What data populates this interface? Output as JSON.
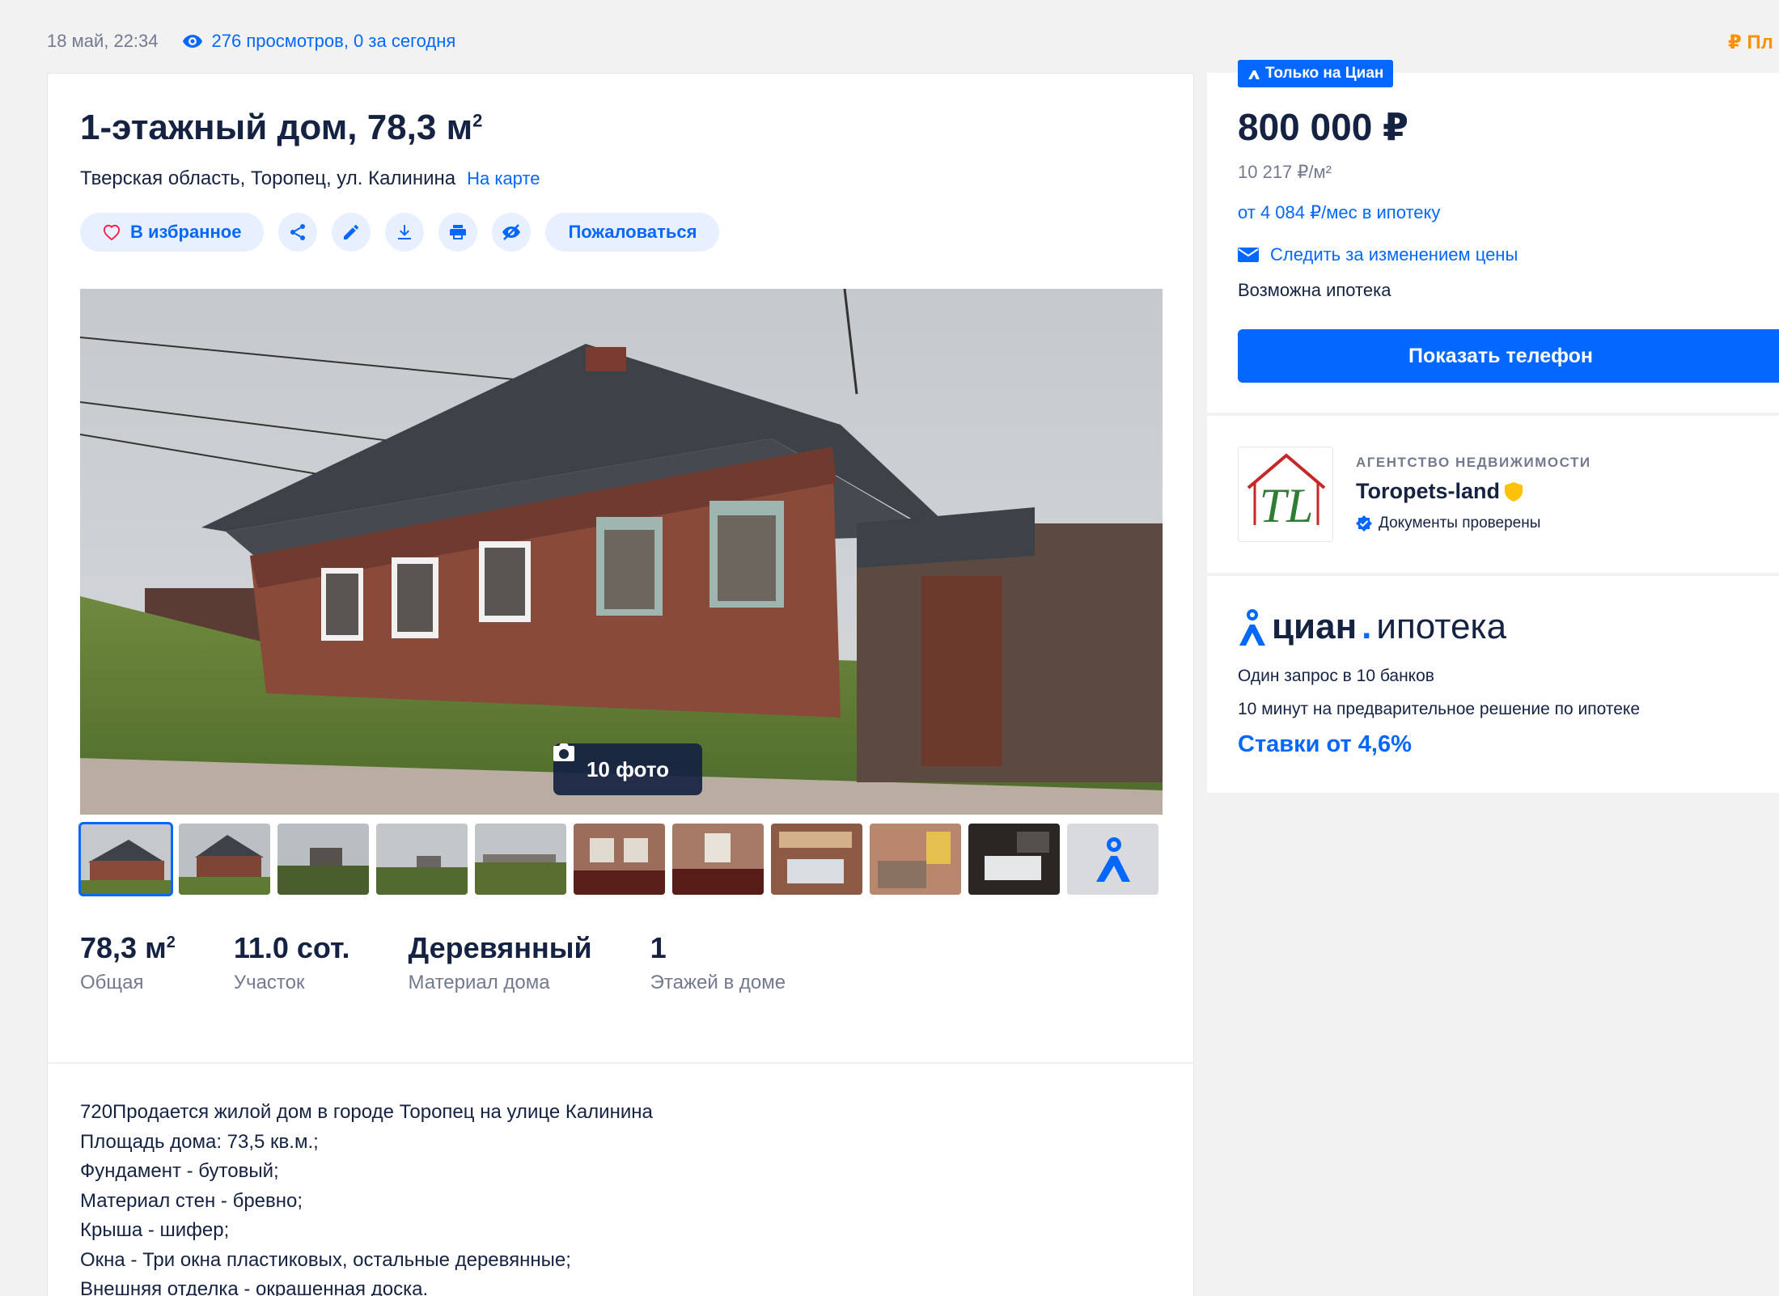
{
  "meta": {
    "date": "18 май, 22:34",
    "views": "276 просмотров, 0 за сегодня",
    "top_right": "₽ Пл"
  },
  "listing": {
    "title": "1-этажный дом, 78,3 м",
    "title_sup": "2",
    "address": "Тверская область, Торопец, ул. Калинина",
    "map_link": "На карте"
  },
  "actions": {
    "favorite": "В избранное",
    "complain": "Пожаловаться"
  },
  "photo": {
    "badge": "10 фото",
    "thumbnail_count": 11
  },
  "facts": [
    {
      "value": "78,3 м",
      "sup": "2",
      "label": "Общая"
    },
    {
      "value": "11.0 сот.",
      "sup": "",
      "label": "Участок"
    },
    {
      "value": "Деревянный",
      "sup": "",
      "label": "Материал дома"
    },
    {
      "value": "1",
      "sup": "",
      "label": "Этажей в доме"
    }
  ],
  "description": [
    "720Продается жилой дом в городе Торопец на улице Калинина",
    "Площадь дома: 73,5 кв.м.;",
    "Фундамент - бутовый;",
    "Материал стен - бревно;",
    "Крыша - шифер;",
    "Окна - Три окна пластиковых, остальные деревянные;",
    "Внешняя отделка - окрашенная доска."
  ],
  "price_block": {
    "only_badge": "Только на Циан",
    "price": "800 000 ₽",
    "price_per_m2": "10 217 ₽/м²",
    "mortgage_from": "от 4 084 ₽/мес в ипотеку",
    "watch_price": "Следить за изменением цены",
    "mortgage_possible": "Возможна ипотека",
    "show_phone": "Показать телефон"
  },
  "agency": {
    "kind": "АГЕНТСТВО НЕДВИЖИМОСТИ",
    "name": "Toropets-land",
    "verified": "Документы проверены",
    "logo_text": "TL"
  },
  "ipoteka": {
    "logo_main": "циан",
    "logo_dot": ".",
    "logo_sub": "ипотека",
    "line1": "Один запрос в 10 банков",
    "line2": "10 минут на предварительное решение по ипотеке",
    "rate": "Ставки от 4,6%"
  },
  "colors": {
    "accent": "#0468ff",
    "text": "#152242",
    "muted": "#737a8e",
    "orange": "#ff9100"
  }
}
